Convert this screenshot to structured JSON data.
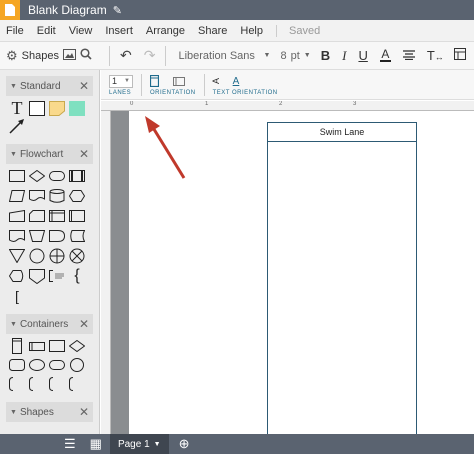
{
  "title_bar": {
    "doc_title": "Blank Diagram",
    "edit_icon": "pencil-icon"
  },
  "menu": {
    "items": [
      "File",
      "Edit",
      "View",
      "Insert",
      "Arrange",
      "Share",
      "Help"
    ],
    "status": "Saved"
  },
  "toolbar": {
    "shapes_label": "Shapes",
    "font_name": "Liberation Sans",
    "font_size": "8",
    "font_unit": "pt",
    "bold": "B",
    "italic": "I",
    "underline": "U",
    "text_color": "A",
    "text_tool": "T"
  },
  "left_panel": {
    "sections": [
      {
        "title": "Standard"
      },
      {
        "title": "Flowchart"
      },
      {
        "title": "Containers"
      },
      {
        "title": "Shapes"
      }
    ]
  },
  "ribbon": {
    "lanes_value": "1",
    "lanes_label": "LANES",
    "orientation_label": "ORIENTATION",
    "orientation2_label": "ORIENTATION",
    "text_orientation_label": "TEXT ORIENTATION"
  },
  "ruler": {
    "marks": [
      "0",
      "1",
      "2",
      "3"
    ]
  },
  "canvas": {
    "swim_lane_title": "Swim Lane"
  },
  "bottom_bar": {
    "page_label": "Page 1"
  },
  "colors": {
    "title_bar": "#5a6370",
    "logo": "#f5a623",
    "swim_lane_border": "#2d5a74",
    "ribbon_accent": "#1f6b8c",
    "arrow": "#c0392b",
    "sticky_note": "#f9d98c",
    "teal_block": "#7fe0c0"
  }
}
